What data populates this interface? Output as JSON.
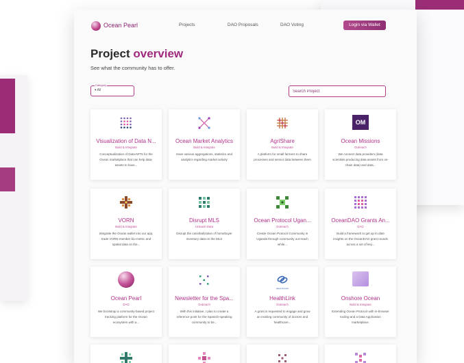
{
  "nav": {
    "brand": "Ocean Pearl",
    "links": [
      "Projects",
      "DAO Proposals",
      "DAO Voting"
    ],
    "login": "Login via Wallet"
  },
  "header": {
    "title_plain": "Project",
    "title_accent": "overview",
    "subtitle": "See what the community has to offer."
  },
  "filters": {
    "category_label": "Category",
    "category_value": "▾ All",
    "search_placeholder": "Search Project"
  },
  "cards": [
    {
      "title": "Visualization of Data N...",
      "tag": "Build & Integrate",
      "desc": "Conceptualization of Data-NFTs for the Ocean marketplace that can help data-assets to have...",
      "icon": "dot-grid-icon"
    },
    {
      "title": "Ocean Market Analytics",
      "tag": "Build & Integrate",
      "desc": "Have various aggregations, statistics and analytics regarding market activity",
      "icon": "network-icon"
    },
    {
      "title": "AgriShare",
      "tag": "Build & Integrate",
      "desc": "A platform for small farmers to share processes and sensor data between them",
      "icon": "lattice-icon"
    },
    {
      "title": "Ocean Missions",
      "tag": "Outreach",
      "desc": "We connect data providers (data scientists producing data assets from on-chain data) and data...",
      "icon": "om-logo-icon",
      "icon_text": "OM"
    },
    {
      "title": "VORN",
      "tag": "Build & Integrate",
      "desc": "Integrate the Ocean wallet into our app, trade VORN-member bio-metric and spatial data on the...",
      "icon": "pixel-cross-icon"
    },
    {
      "title": "Disrupt MLS",
      "tag": "Unleash Data",
      "desc": "Disrupt the cannibalization of homebuyer inventory data on the MLS",
      "icon": "pixel-pattern-icon"
    },
    {
      "title": "Ocean Protocol Ugan...",
      "tag": "Outreach",
      "desc": "Create Ocean Protocol Community in Uganda through community out-reach while...",
      "icon": "pixel-square-icon"
    },
    {
      "title": "OceanDAO Grants An...",
      "tag": "DAO",
      "desc": "Build a framework to get up to date insights on the OceanDAO grant rounds across a set of key...",
      "icon": "pixel-grid-icon"
    },
    {
      "title": "Ocean Pearl",
      "tag": "DAO",
      "desc": "We bootstrap a community-based project tracking platform for the Ocean ecosystem with a...",
      "icon": "pearl-icon"
    },
    {
      "title": "Newsletter for the Spa...",
      "tag": "Outreach",
      "desc": "With this initiative, I plan to create a reference point for the Spanish-speaking community to be...",
      "icon": "dots-icon"
    },
    {
      "title": "HealthLink",
      "tag": "Outreach",
      "desc": "A grant is requested to engage and grow an existing community of doctors and healthcare...",
      "icon": "healthlink-icon",
      "icon_caption": "HEALTHLINK"
    },
    {
      "title": "Onshore Ocean",
      "tag": "Build & Integrate",
      "desc": "Extending Ocean Protocol with in-browser tooling and a Data Application marketplace.",
      "icon": "onshore-icon"
    }
  ],
  "colors": {
    "accent": "#a0287d",
    "accent_dark": "#8e2f73",
    "sheet_bg": "#fafafa"
  }
}
